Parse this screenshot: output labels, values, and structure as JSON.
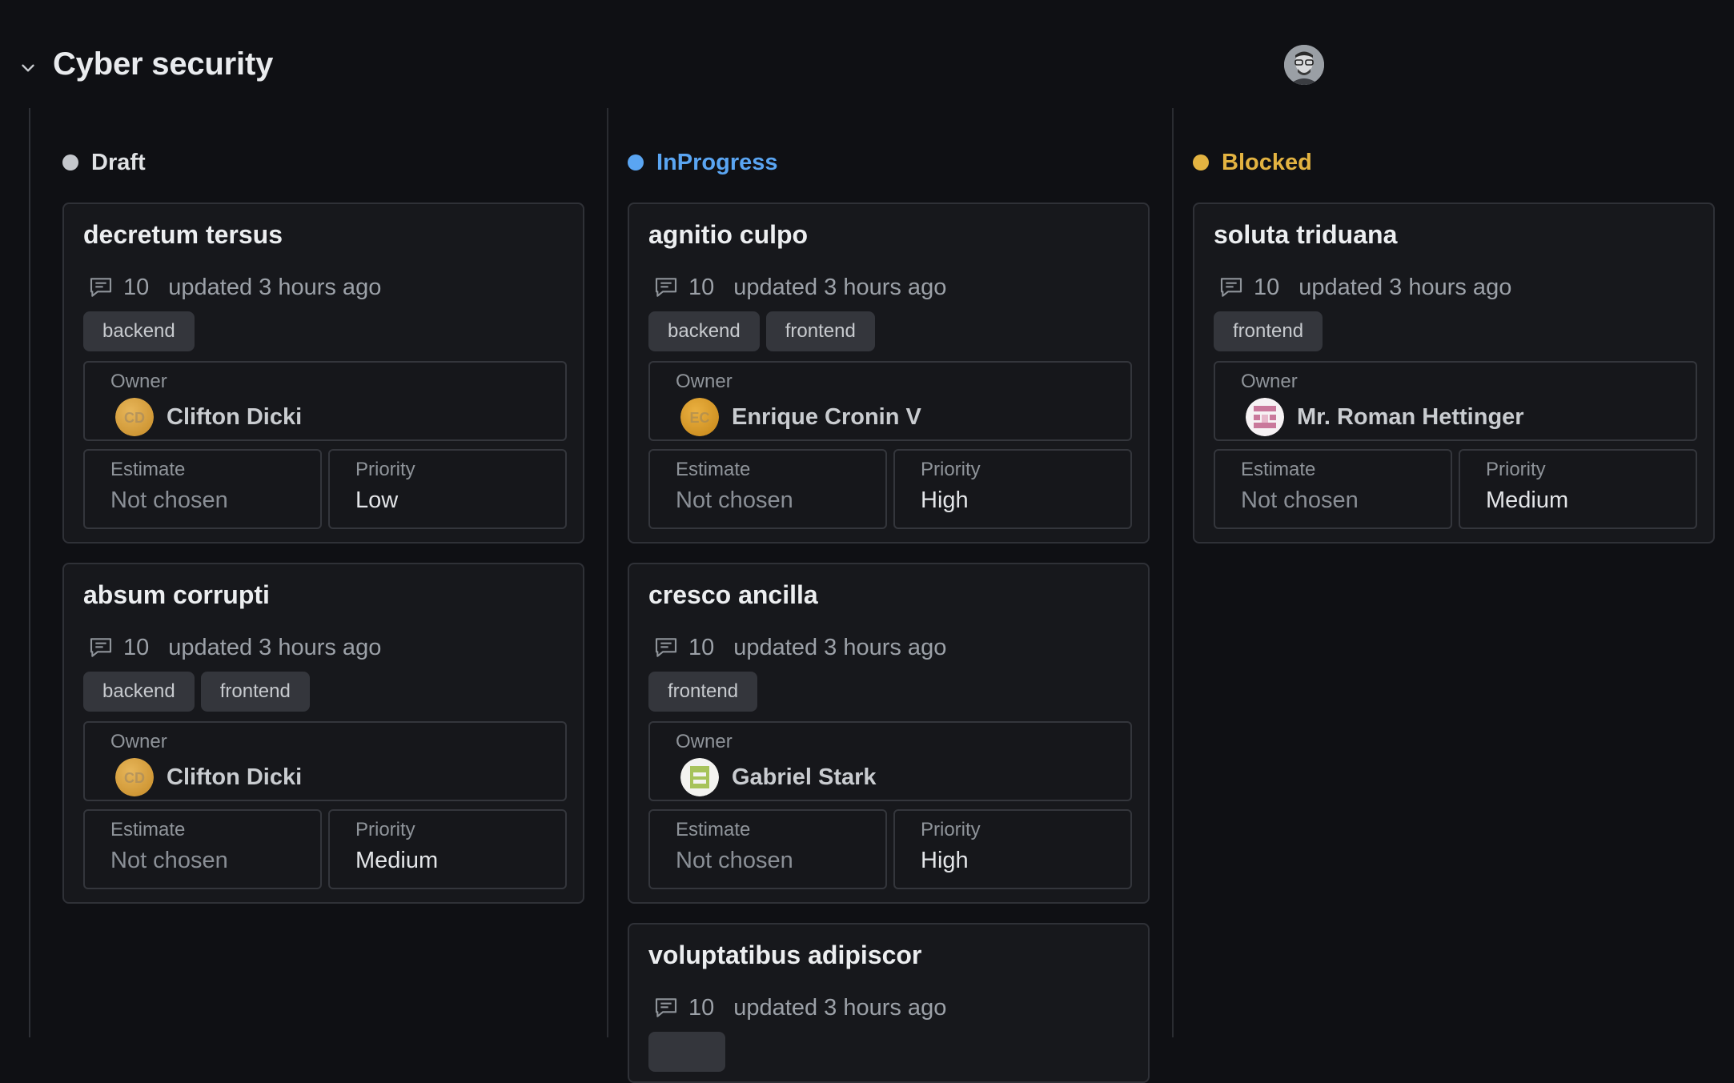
{
  "group": {
    "title": "Cyber security"
  },
  "labels": {
    "owner": "Owner",
    "estimate": "Estimate",
    "priority": "Priority"
  },
  "columns": [
    {
      "name": "Draft",
      "color": "#c4c7cc",
      "cards": [
        {
          "title": "decretum tersus",
          "comments": "10",
          "updated": "updated 3 hours ago",
          "tags": [
            "backend"
          ],
          "owner": "Clifton Dicki",
          "owner_initials": "CD",
          "estimate": "Not chosen",
          "priority": "Low"
        },
        {
          "title": "absum corrupti",
          "comments": "10",
          "updated": "updated 3 hours ago",
          "tags": [
            "backend",
            "frontend"
          ],
          "owner": "Clifton Dicki",
          "owner_initials": "CD",
          "estimate": "Not chosen",
          "priority": "Medium"
        }
      ]
    },
    {
      "name": "InProgress",
      "color": "#5aa5f2",
      "cards": [
        {
          "title": "agnitio culpo",
          "comments": "10",
          "updated": "updated 3 hours ago",
          "tags": [
            "backend",
            "frontend"
          ],
          "owner": "Enrique Cronin V",
          "owner_initials": "EC",
          "estimate": "Not chosen",
          "priority": "High"
        },
        {
          "title": "cresco ancilla",
          "comments": "10",
          "updated": "updated 3 hours ago",
          "tags": [
            "frontend"
          ],
          "owner": "Gabriel Stark",
          "estimate": "Not chosen",
          "priority": "High"
        },
        {
          "title": "voluptatibus adipiscor",
          "comments": "10",
          "updated": "updated 3 hours ago"
        }
      ]
    },
    {
      "name": "Blocked",
      "color": "#e3b341",
      "cards": [
        {
          "title": "soluta triduana",
          "comments": "10",
          "updated": "updated 3 hours ago",
          "tags": [
            "frontend"
          ],
          "owner": "Mr. Roman Hettinger",
          "estimate": "Not chosen",
          "priority": "Medium"
        }
      ]
    }
  ]
}
